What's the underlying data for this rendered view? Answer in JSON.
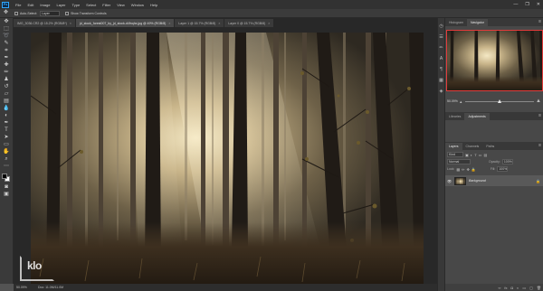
{
  "app": {
    "logo": "Ps"
  },
  "menu": [
    "File",
    "Edit",
    "Image",
    "Layer",
    "Type",
    "Select",
    "Filter",
    "View",
    "Window",
    "Help"
  ],
  "window_controls": {
    "minimize": "—",
    "restore": "❐",
    "close": "✕"
  },
  "options_bar": {
    "auto_select_label": "Auto-Select:",
    "auto_select_target": "Layer",
    "transform_label": "Show Transform Controls"
  },
  "doc_tabs": [
    {
      "label": "IMG_3036.CR2 @ 15.2% (RGB/8*)",
      "active": false
    },
    {
      "label": "jd_stock_forest007_by_jd_stock-d4fnqhx.jpg @ 49% (RGB/8)",
      "active": true
    },
    {
      "label": "Layer 1 @ 15.7% (RGB/8)",
      "active": false
    },
    {
      "label": "Layer 0 @ 15.7% (RGB/8)",
      "active": false
    }
  ],
  "tab_close": "×",
  "status": {
    "zoom": "50.09%",
    "doc": "Doc: 11.0M/11.0M"
  },
  "watermark": {
    "text": "klo"
  },
  "panels": {
    "top_tabs": [
      "Histogram",
      "Navigator"
    ],
    "top_active": 1,
    "navigator_zoom": "50.09%",
    "mid_tabs": [
      "Libraries",
      "Adjustments"
    ],
    "mid_active": 1,
    "layer_tabs": [
      "Layers",
      "Channels",
      "Paths"
    ],
    "layer_active": 0,
    "kind_label": "Kind",
    "blend_mode": "Normal",
    "opacity_label": "Opacity:",
    "opacity_value": "100%",
    "lock_label": "Lock:",
    "fill_label": "Fill:",
    "fill_value": "100%",
    "layer_name": "Background",
    "menu_icon": "≡"
  },
  "colors": {
    "accent_nav_box": "#e23b3b",
    "ps_blue": "#31a8ff"
  }
}
